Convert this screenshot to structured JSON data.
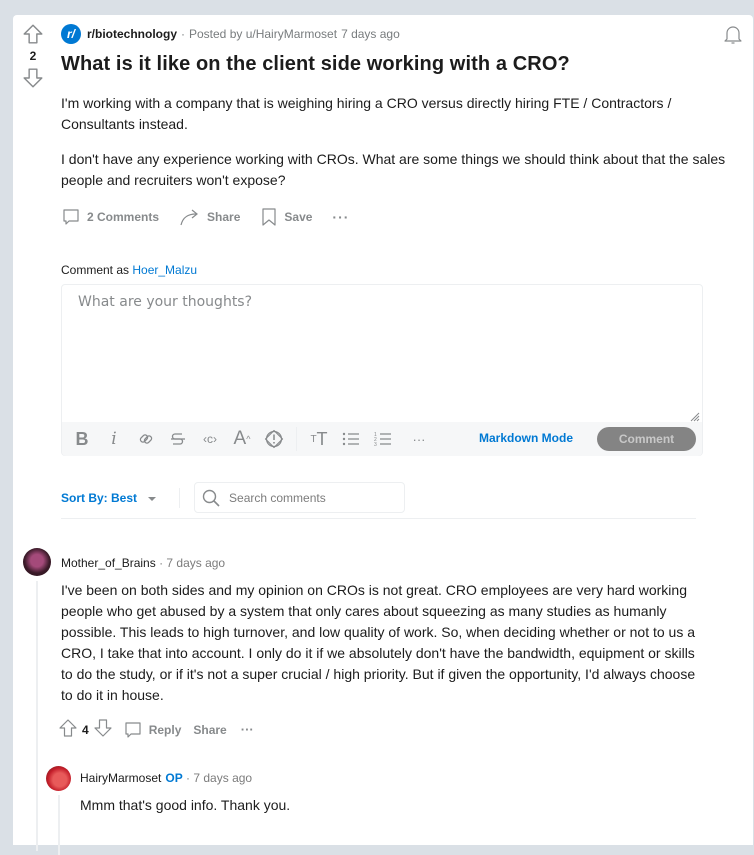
{
  "post": {
    "score": "2",
    "subreddit": "r/biotechnology",
    "subreddit_icon": "r/",
    "posted_by": "Posted by u/HairyMarmoset",
    "time": "7 days ago",
    "title": "What is it like on the client side working with a CRO?",
    "body": [
      "I'm working with a company that is weighing hiring a CRO versus directly hiring FTE / Contractors / Consultants instead.",
      "I don't have any experience working with CROs. What are some things we should think about that the sales people and recruiters won't expose?"
    ],
    "actions": {
      "comments": "2 Comments",
      "share": "Share",
      "save": "Save",
      "more": "···"
    }
  },
  "composer": {
    "comment_as_label": "Comment as",
    "username": "Hoer_Malzu",
    "placeholder": "What are your thoughts?",
    "toolbar": {
      "bold": "B",
      "italic": "i",
      "code": "‹c›",
      "more": "···"
    },
    "markdown_mode": "Markdown Mode",
    "submit_label": "Comment"
  },
  "sort": {
    "label": "Sort By: Best",
    "search_placeholder": "Search comments"
  },
  "comments": [
    {
      "author": "Mother_of_Brains",
      "time": "· 7 days ago",
      "text": "I've been on both sides and my opinion on CROs is not great. CRO employees are very hard working people who get abused by a system that only cares about squeezing as many studies as humanly possible. This leads to high turnover, and low quality of work. So, when deciding whether or not to us a CRO, I take that into account. I only do it if we absolutely don't have the bandwidth, equipment or skills to do the study, or if it's not a super crucial / high priority. But if given the opportunity, I'd always choose to do it in house.",
      "score": "4",
      "reply": "Reply",
      "share": "Share",
      "more": "···"
    },
    {
      "author": "HairyMarmoset",
      "op_badge": "OP",
      "time": "· 7 days ago",
      "text": "Mmm that's good info. Thank you."
    }
  ],
  "colors": {
    "accent": "#0079d3",
    "page_bg": "#dae0e6",
    "muted": "#878a8c"
  }
}
